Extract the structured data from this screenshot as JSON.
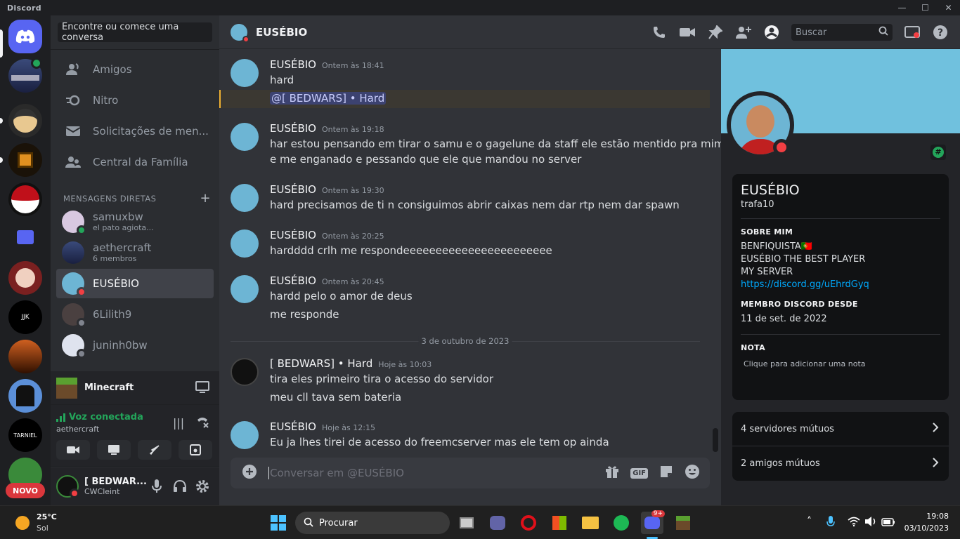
{
  "app": {
    "title": "Discord"
  },
  "guilds": {
    "novo_badge": "NOVO"
  },
  "sidebar": {
    "search_placeholder": "Encontre ou comece uma conversa",
    "nav": [
      {
        "label": "Amigos",
        "icon": "friends-icon"
      },
      {
        "label": "Nitro",
        "icon": "nitro-icon"
      },
      {
        "label": "Solicitações de men...",
        "icon": "inbox-icon"
      },
      {
        "label": "Central da Família",
        "icon": "family-icon"
      }
    ],
    "dm_header": "MENSAGENS DIRETAS",
    "dms": [
      {
        "name": "samuxbw",
        "sub": "el pato agiota...",
        "status": "online"
      },
      {
        "name": "aethercraft",
        "sub": "6 membros",
        "status": ""
      },
      {
        "name": "EUSÉBIO",
        "sub": "",
        "status": "dnd"
      },
      {
        "name": "6Lilith9",
        "sub": "",
        "status": "offline"
      },
      {
        "name": "juninh0bw",
        "sub": "",
        "status": "offline"
      }
    ],
    "activity": {
      "game": "Minecraft"
    },
    "voice": {
      "status": "Voz conectada",
      "channel": "aethercraft"
    },
    "user": {
      "name": "[ BEDWAR...",
      "tag": "CWCleint"
    }
  },
  "header": {
    "title": "EUSÉBIO",
    "search_placeholder": "Buscar"
  },
  "messages": [
    {
      "author": "EUSÉBIO",
      "time": "Ontem às 18:41",
      "lines": [
        "hard"
      ],
      "mention": "@[ BEDWARS] • Hard"
    },
    {
      "author": "EUSÉBIO",
      "time": "Ontem às 19:18",
      "lines": [
        "har estou pensando em tirar o samu e o gagelune da staff ele estão mentido pra mim",
        "e me enganado e pessando que ele que mandou no server"
      ]
    },
    {
      "author": "EUSÉBIO",
      "time": "Ontem às 19:30",
      "lines": [
        "hard precisamos de ti n consiguimos abrir caixas nem dar rtp nem dar spawn"
      ]
    },
    {
      "author": "EUSÉBIO",
      "time": "Ontem às 20:25",
      "lines": [
        "hardddd crlh me respondeeeeeeeeeeeeeeeeeeeeeee"
      ]
    },
    {
      "author": "EUSÉBIO",
      "time": "Ontem às 20:45",
      "lines": [
        "hardd pelo o amor de deus",
        "me responde"
      ]
    },
    {
      "author": "[ BEDWARS] • Hard",
      "time": "Hoje às 10:03",
      "lines": [
        "tira eles primeiro tira o acesso do servidor",
        "meu cll tava sem bateria"
      ]
    },
    {
      "author": "EUSÉBIO",
      "time": "Hoje às 12:15",
      "lines": [
        "Eu ja lhes tirei de acesso do freemcserver mas ele tem op ainda"
      ]
    }
  ],
  "date_divider": "3 de outubro de 2023",
  "composer": {
    "placeholder": "Conversar em @EUSÉBIO",
    "gif": "GIF"
  },
  "profile": {
    "display_name": "EUSÉBIO",
    "username": "trafa10",
    "about_header": "SOBRE MIM",
    "about_lines": [
      "BENFIQUISTA🇵🇹",
      "EUSÉBIO THE BEST PLAYER",
      "MY SERVER"
    ],
    "about_link": "https://discord.gg/uEhrdGyq",
    "member_since_header": "MEMBRO DISCORD DESDE",
    "member_since": "11 de set. de 2022",
    "note_header": "NOTA",
    "note_placeholder": "Clique para adicionar uma nota",
    "mutual_servers": "4 servidores mútuos",
    "mutual_friends": "2 amigos mútuos"
  },
  "taskbar": {
    "weather_temp": "25°C",
    "weather_desc": "Sol",
    "search": "Procurar",
    "discord_badge": "9+",
    "time": "19:08",
    "date": "03/10/2023"
  },
  "colors": {
    "accent": "#5865f2",
    "dnd": "#f23f43",
    "online": "#23a55a",
    "link": "#00a8fc",
    "banner": "#70c1de"
  }
}
